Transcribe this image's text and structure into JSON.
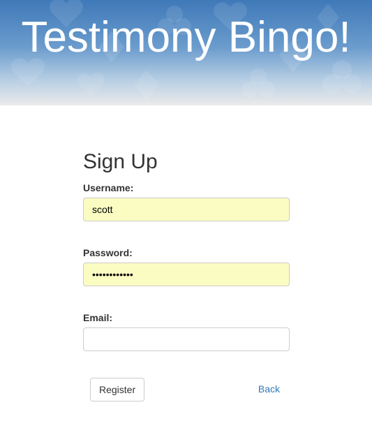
{
  "header": {
    "title": "Testimony Bingo!"
  },
  "signup": {
    "title": "Sign Up",
    "username_label": "Username:",
    "username_value": "scott",
    "password_label": "Password:",
    "password_value": "••••••••••••",
    "email_label": "Email:",
    "email_value": "",
    "register_label": "Register",
    "back_label": "Back"
  },
  "colors": {
    "banner_top": "#3f79b8",
    "autofill_bg": "#fbfcc2",
    "link": "#337ab7"
  }
}
